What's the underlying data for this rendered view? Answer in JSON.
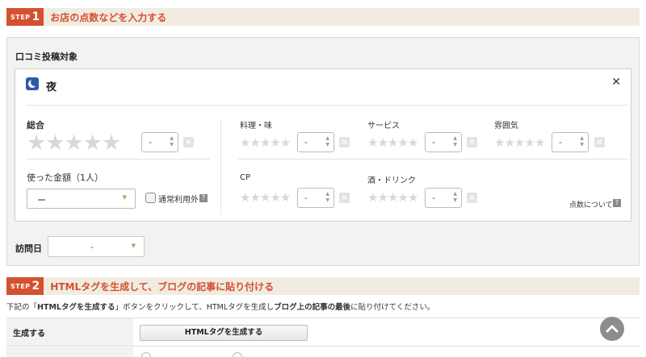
{
  "step1": {
    "step_word": "STEP",
    "step_num": "1",
    "title": "お店の点数などを入力する"
  },
  "review_target": {
    "label": "口コミ投稿対象"
  },
  "card": {
    "time_icon": "moon-icon",
    "time_label": "夜",
    "close_icon": "close-icon",
    "overall": {
      "label": "総合",
      "stars": 5,
      "rating_value": "-"
    },
    "amount": {
      "label": "使った金額（1人）",
      "value": "ー",
      "checkbox_label": "通常利用外",
      "help_icon": "?"
    },
    "subratings": [
      {
        "label": "料理・味",
        "stars": 5,
        "value": "-"
      },
      {
        "label": "サービス",
        "stars": 5,
        "value": "-"
      },
      {
        "label": "雰囲気",
        "stars": 5,
        "value": "-"
      },
      {
        "label": "CP",
        "stars": 5,
        "value": "-"
      },
      {
        "label": "酒・ドリンク",
        "stars": 5,
        "value": "-"
      }
    ],
    "points_link": "点数について",
    "points_help_icon": "?",
    "clear_icon": "×"
  },
  "visit": {
    "label": "訪問日",
    "value": "-"
  },
  "step2": {
    "step_word": "STEP",
    "step_num": "2",
    "title": "HTMLタグを生成して、ブログの記事に貼り付ける",
    "desc_pre": "下記の「",
    "desc_bold1": "HTMLタグを生成する",
    "desc_mid": "」ボタンをクリックして、HTMLタグを生成し",
    "desc_bold2": "ブログ上の記事の最後",
    "desc_post": "に貼り付けてください。",
    "generate_label": "生成する",
    "generate_button": "HTMLタグを生成する"
  },
  "colors": {
    "accent": "#d4502e",
    "panel_bg": "#f2f2f2",
    "header_bg": "#f1ece2",
    "star_empty": "#d8d8d8",
    "moon_blue": "#2f5aa6"
  },
  "scroll_top_icon": "chevron-up-icon"
}
